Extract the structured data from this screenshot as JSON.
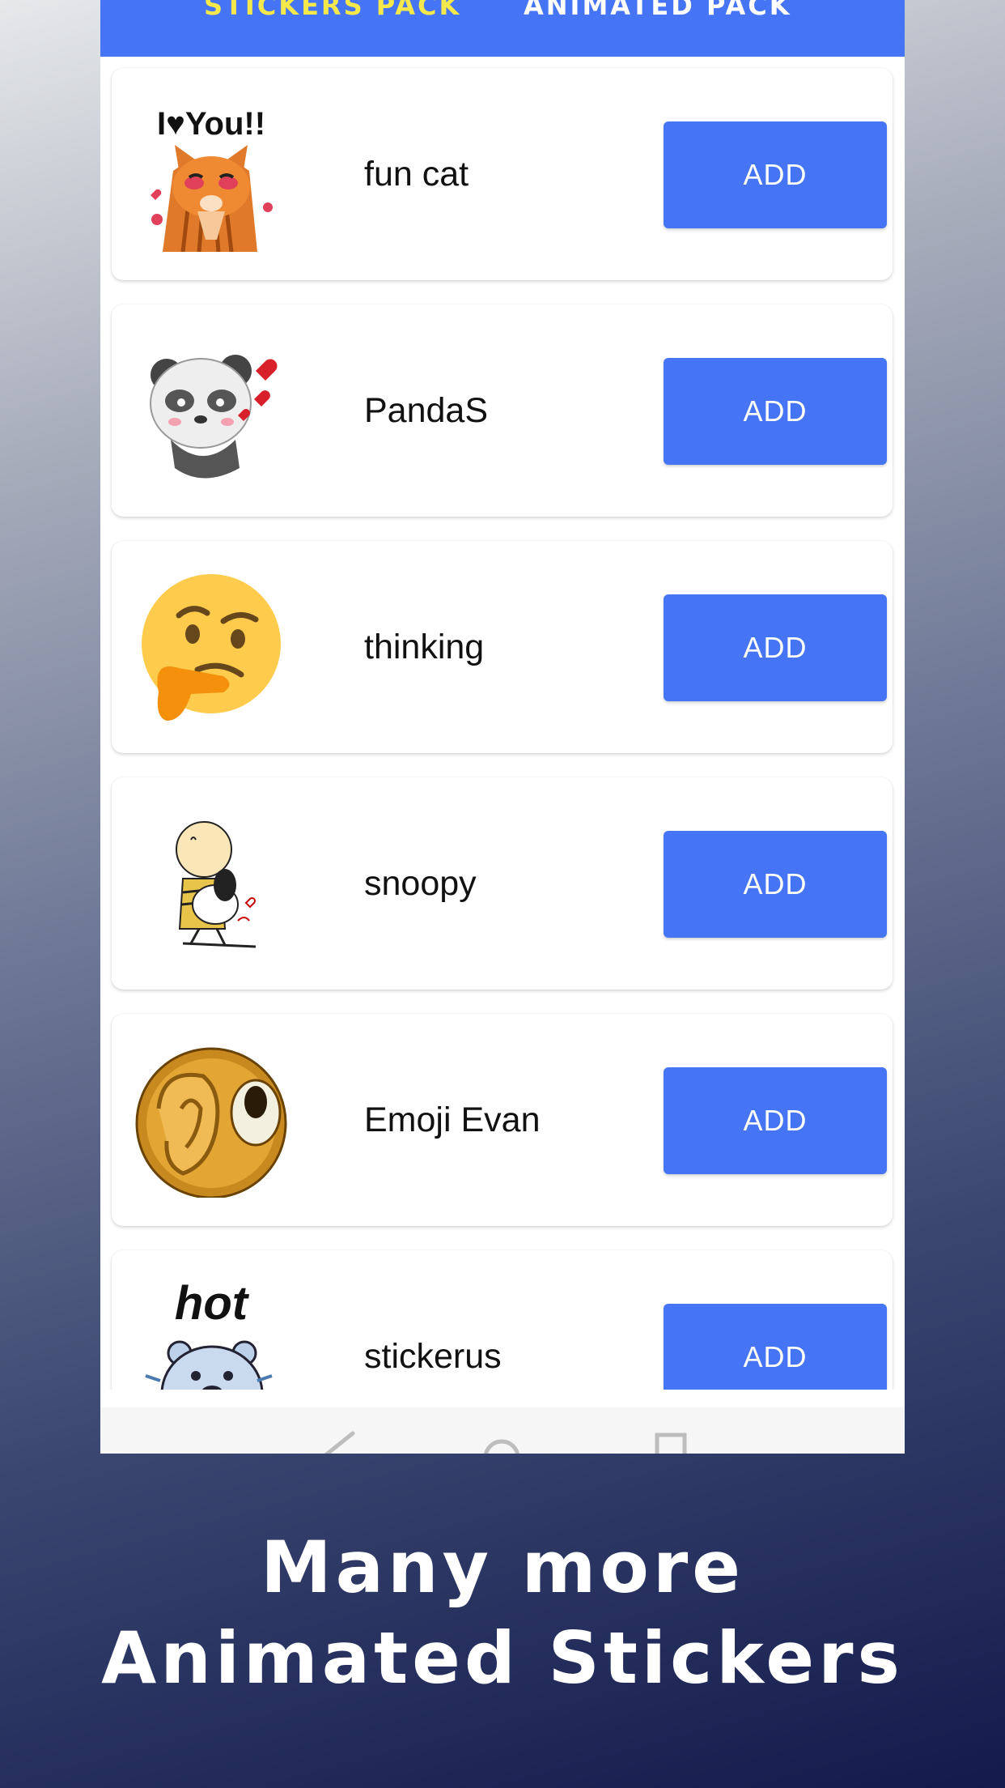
{
  "tabs": [
    {
      "label": "STICKERS PACK",
      "active": true
    },
    {
      "label": "ANIMATED PACK",
      "active": false
    }
  ],
  "packs": [
    {
      "name": "fun cat",
      "button": "ADD",
      "icon": "cat-sticker-icon"
    },
    {
      "name": "PandaS",
      "button": "ADD",
      "icon": "panda-sticker-icon"
    },
    {
      "name": "thinking",
      "button": "ADD",
      "icon": "thinking-face-icon"
    },
    {
      "name": "snoopy",
      "button": "ADD",
      "icon": "snoopy-sticker-icon"
    },
    {
      "name": "Emoji Evan",
      "button": "ADD",
      "icon": "ear-emoji-icon"
    },
    {
      "name": "stickerus",
      "button": "ADD",
      "icon": "hot-bear-sticker-icon"
    }
  ],
  "cat_sticker_text": "I♥You!!",
  "bear_sticker_text": "hot",
  "caption": {
    "line1": "Many more",
    "line2": "Animated Stickers"
  },
  "colors": {
    "accent": "#4574f4",
    "active_tab": "#f4e84a"
  }
}
